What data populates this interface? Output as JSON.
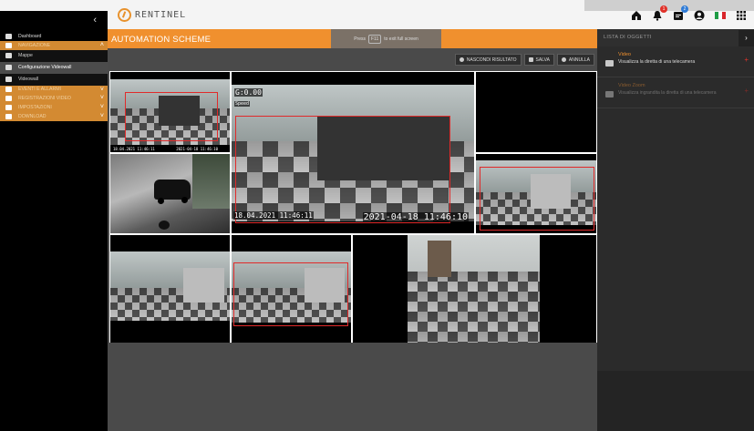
{
  "brand": {
    "name": "RENTINEL"
  },
  "topbar": {
    "badges": {
      "notifications": "1",
      "messages": "2"
    },
    "flag_colors": [
      "#1f9c45",
      "#ffffff",
      "#d9262c"
    ]
  },
  "sidebar": {
    "toggle_icon": "chevron-left-icon",
    "items": [
      {
        "label": "Dashboard",
        "icon": "home-icon"
      },
      {
        "label": "NAVIGAZIONE",
        "icon": "navigation-icon"
      },
      {
        "label": "Mappe",
        "icon": "map-icon"
      },
      {
        "label": "Configurazione Videowall",
        "icon": "videowall-config-icon"
      },
      {
        "label": "Videowall",
        "icon": "videowall-icon"
      },
      {
        "label": "EVENTI E ALLARMI",
        "icon": "alarm-icon"
      },
      {
        "label": "REGISTRAZIONI VIDEO",
        "icon": "video-icon"
      },
      {
        "label": "IMPOSTAZIONI",
        "icon": "settings-icon"
      },
      {
        "label": "DOWNLOAD",
        "icon": "download-icon"
      }
    ]
  },
  "main": {
    "title": "AUTOMATION SCHEME",
    "fullscreen_tip": {
      "before": "Press",
      "key": "F11",
      "after": "to exit full screen"
    },
    "buttons": {
      "hide_result": "NASCONDI RISULTATO",
      "save": "SALVA",
      "cancel": "ANNULLA"
    },
    "tiles": {
      "t1_timestamp": "18.04.2021 11:46:11",
      "t1_timestamp2": "2021-04-18 11:46:10",
      "big_counter": "G:0.00",
      "big_label": "Speed",
      "big_timestamp": "18.04.2021 11:46:11",
      "big_timestamp2": "2021-04-18 11:46:10"
    }
  },
  "right_panel": {
    "title": "LISTA DI OGGETTI",
    "items": [
      {
        "name": "Video",
        "description": "Visualizza la diretta di una telecamera",
        "icon": "camera-icon"
      },
      {
        "name": "Video Zoom",
        "description": "Visualizza ingrandita la diretta di una telecamera",
        "icon": "camera-zoom-icon"
      }
    ]
  },
  "colors": {
    "accent": "#f0902e",
    "sidebar_orange": "#d38a32",
    "roi_red": "#e02a2a",
    "badge_red": "#e0322a",
    "badge_blue": "#2f7bd6"
  }
}
